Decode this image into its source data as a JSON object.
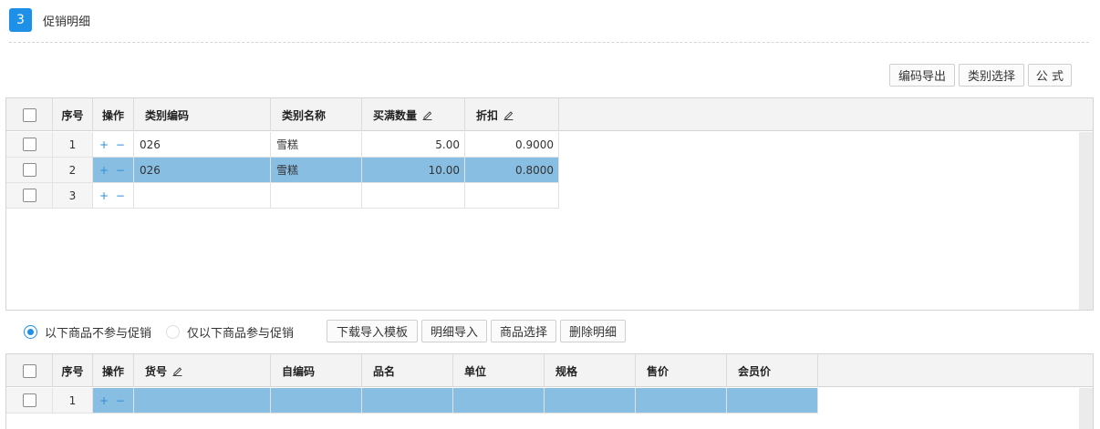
{
  "section": {
    "number": "3",
    "title": "促销明细"
  },
  "toolbar_top": {
    "export_code": "编码导出",
    "category_select": "类别选择",
    "formula": "公 式"
  },
  "grid1": {
    "headers": {
      "seq": "序号",
      "op": "操作",
      "code": "类别编码",
      "name": "类别名称",
      "qty": "买满数量",
      "discount": "折扣"
    },
    "rows": [
      {
        "seq": "1",
        "ops": "+ −",
        "code": "026",
        "name": "雪糕",
        "qty": "5.00",
        "discount": "0.9000",
        "selected": false
      },
      {
        "seq": "2",
        "ops": "+ −",
        "code": "026",
        "name": "雪糕",
        "qty": "10.00",
        "discount": "0.8000",
        "selected": true
      },
      {
        "seq": "3",
        "ops": "+ −",
        "code": "",
        "name": "",
        "qty": "",
        "discount": "",
        "selected": false
      }
    ]
  },
  "options": {
    "exclude_label": "以下商品不参与促销",
    "include_label": "仅以下商品参与促销",
    "selected": "exclude",
    "download_template": "下载导入模板",
    "import_detail": "明细导入",
    "product_select": "商品选择",
    "delete_detail": "删除明细"
  },
  "grid2": {
    "headers": {
      "seq": "序号",
      "op": "操作",
      "item_no": "货号",
      "self_code": "自编码",
      "product_name": "品名",
      "unit": "单位",
      "spec": "规格",
      "price": "售价",
      "member_price": "会员价"
    },
    "rows": [
      {
        "seq": "1",
        "ops": "+ −",
        "selected": true
      }
    ]
  },
  "colors": {
    "accent": "#1e90e8",
    "selected_row": "#89bee3",
    "header_bg": "#f3f3f3"
  }
}
